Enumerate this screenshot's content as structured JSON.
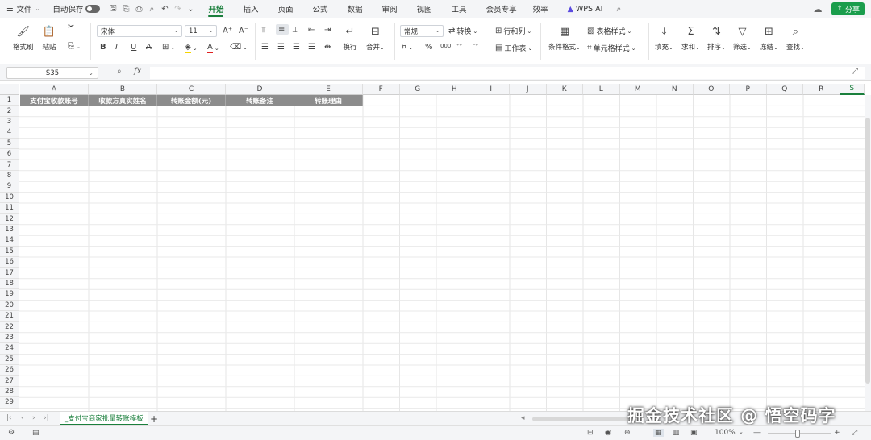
{
  "menubar": {
    "file_label": "文件",
    "autosave_label": "自动保存",
    "tabs": [
      "开始",
      "插入",
      "页面",
      "公式",
      "数据",
      "审阅",
      "视图",
      "工具",
      "会员专享",
      "效率",
      "WPS AI"
    ],
    "share_label": "分享"
  },
  "ribbon": {
    "format_painter": "格式刷",
    "paste": "粘贴",
    "font_name": "宋体",
    "font_size": "11",
    "wrap": "换行",
    "merge": "合并",
    "number_format": "常规",
    "convert": "转换",
    "rows_cols": "行和列",
    "worksheet": "工作表",
    "cond_format": "条件格式",
    "table_style": "表格样式",
    "cell_style": "单元格样式",
    "fill": "填充",
    "sum": "求和",
    "sort": "排序",
    "filter": "筛选",
    "freeze": "冻结",
    "find": "查找"
  },
  "formula_bar": {
    "name_box": "S35",
    "fx": "fx"
  },
  "sheet": {
    "columns": [
      "A",
      "B",
      "C",
      "D",
      "E",
      "F",
      "G",
      "H",
      "I",
      "J",
      "K",
      "L",
      "M",
      "N",
      "O",
      "P",
      "Q",
      "R",
      "S"
    ],
    "rows": [
      "1",
      "2",
      "3",
      "4",
      "5",
      "6",
      "7",
      "8",
      "9",
      "10",
      "11",
      "12",
      "13",
      "14",
      "15",
      "16",
      "17",
      "18",
      "19",
      "20",
      "21",
      "22",
      "23",
      "24",
      "25",
      "26",
      "27",
      "28",
      "29"
    ],
    "header_cells": [
      "支付宝收款账号",
      "收款方真实姓名",
      "转账金额(元)",
      "转账备注",
      "转账理由"
    ]
  },
  "sheet_tab": "_支付宝商家批量转账模板",
  "status": {
    "zoom": "100%"
  },
  "watermark": "掘金技术社区 @ 悟空码字",
  "colors": {
    "accent": "#1a7f3c",
    "header_fill": "#8c8c8c",
    "share_button": "#1a9d4c"
  }
}
